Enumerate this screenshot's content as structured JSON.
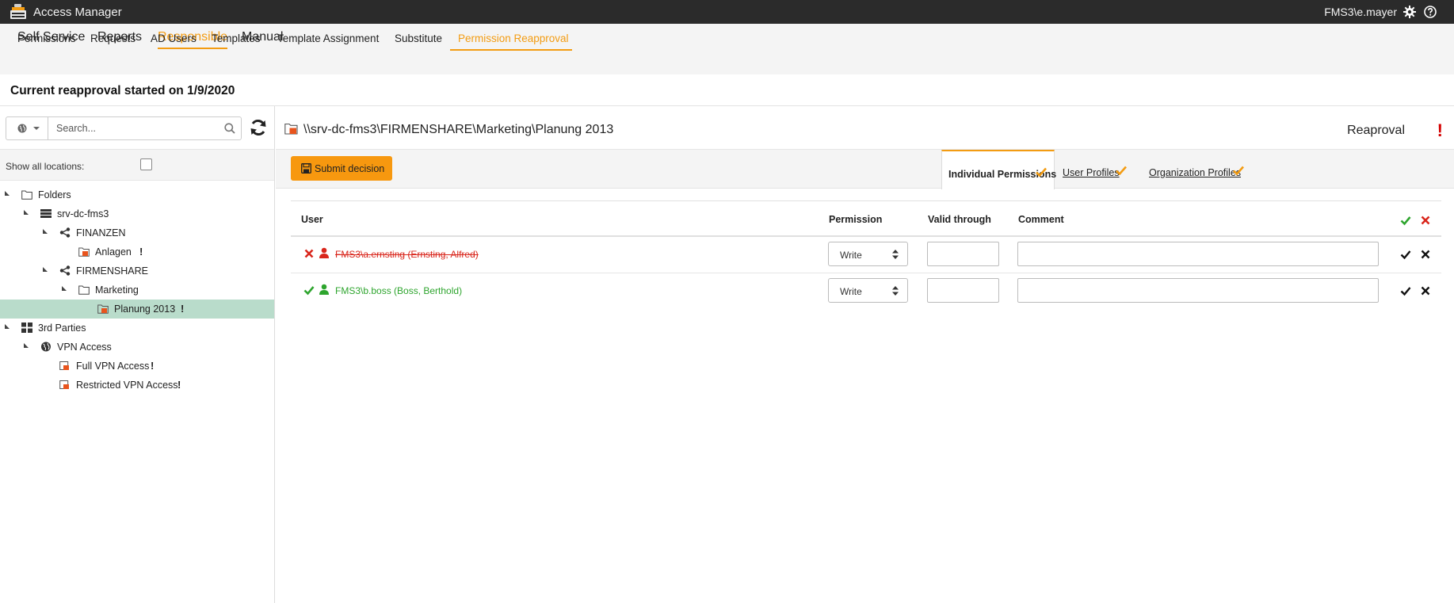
{
  "app": {
    "title": "Access Manager",
    "user": "FMS3\\e.mayer"
  },
  "main_nav": [
    "Self Service",
    "Reports",
    "Responsible",
    "Manual"
  ],
  "sub_nav": [
    "Permissions",
    "Requests",
    "AD Users",
    "Templates",
    "Template Assignment",
    "Substitute",
    "Permission Reapproval"
  ],
  "heading": "Current reapproval started on 1/9/2020",
  "search": {
    "placeholder": "Search..."
  },
  "filter": {
    "show_all_label": "Show all locations:",
    "show_all_checked": false
  },
  "tree": [
    {
      "label": "Folders"
    },
    {
      "label": "srv-dc-fms3"
    },
    {
      "label": "FINANZEN"
    },
    {
      "label": "Anlagen",
      "flag": "!"
    },
    {
      "label": "FIRMENSHARE"
    },
    {
      "label": "Marketing"
    },
    {
      "label": "Planung 2013",
      "flag": "!",
      "selected": true
    },
    {
      "label": "3rd Parties"
    },
    {
      "label": "VPN Access"
    },
    {
      "label": "Full VPN Access",
      "flag": "!"
    },
    {
      "label": "Restricted VPN Access",
      "flag": "!"
    }
  ],
  "detail": {
    "path": "\\\\srv-dc-fms3\\FIRMENSHARE\\Marketing\\Planung 2013",
    "status_label": "Reaproval",
    "status_flag": "!",
    "submit_label": "Submit decision",
    "tabs": [
      "Individual Permissions",
      "User Profiles",
      "Organization Profiles"
    ]
  },
  "table": {
    "headers": {
      "user": "User",
      "permission": "Permission",
      "valid": "Valid through",
      "comment": "Comment"
    },
    "rows": [
      {
        "user": "FMS3\\a.ernsting (Ernsting, Alfred)",
        "decision": "rejected",
        "permission": "Write",
        "valid": "",
        "comment": ""
      },
      {
        "user": "FMS3\\b.boss (Boss, Berthold)",
        "decision": "approved",
        "permission": "Write",
        "valid": "",
        "comment": ""
      }
    ]
  },
  "colors": {
    "accent": "#f39c12",
    "approve": "#2ea52e",
    "reject": "#d9261c",
    "selected_row": "#b9dccb"
  }
}
